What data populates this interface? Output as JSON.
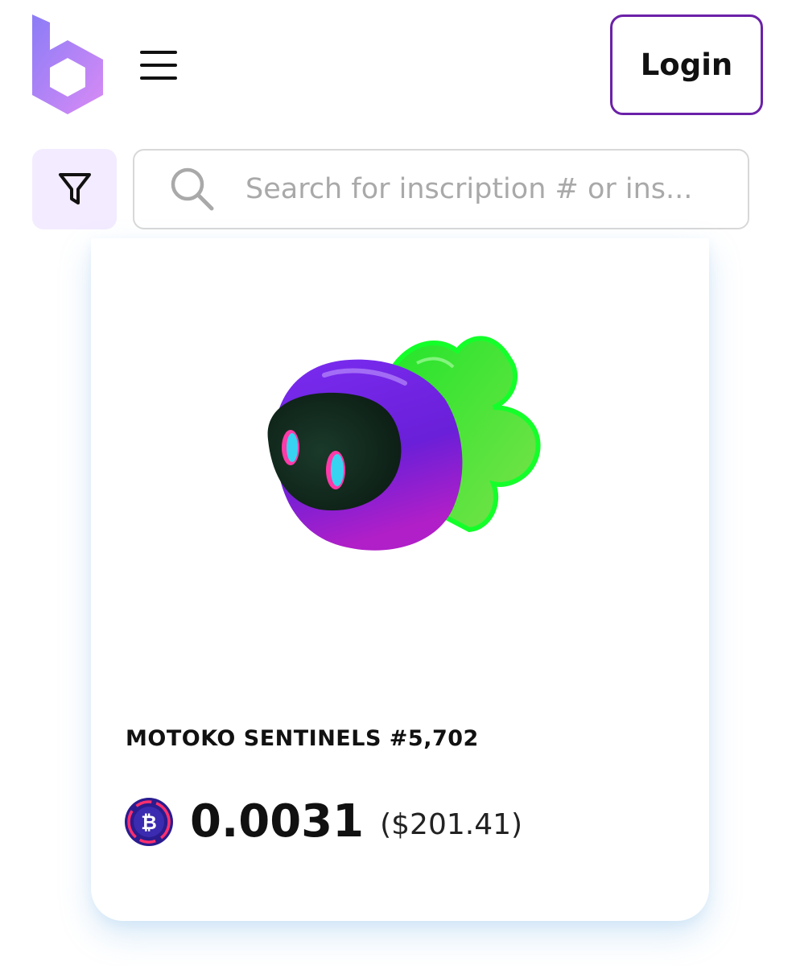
{
  "header": {
    "logo_icon": "brand-b-logo-icon",
    "menu_icon": "hamburger-menu-icon",
    "login_label": "Login",
    "accent_color": "#6b21a8"
  },
  "search": {
    "filter_icon": "filter-icon",
    "search_icon": "search-icon",
    "placeholder": "Search for inscription # or ins...",
    "value": ""
  },
  "card": {
    "image": "ghost-robot-nft-image",
    "title": "MOTOKO SENTINELS #5,702",
    "currency_icon": "bitcoin-icon",
    "price_btc": "0.0031",
    "price_usd": "($201.41)"
  }
}
